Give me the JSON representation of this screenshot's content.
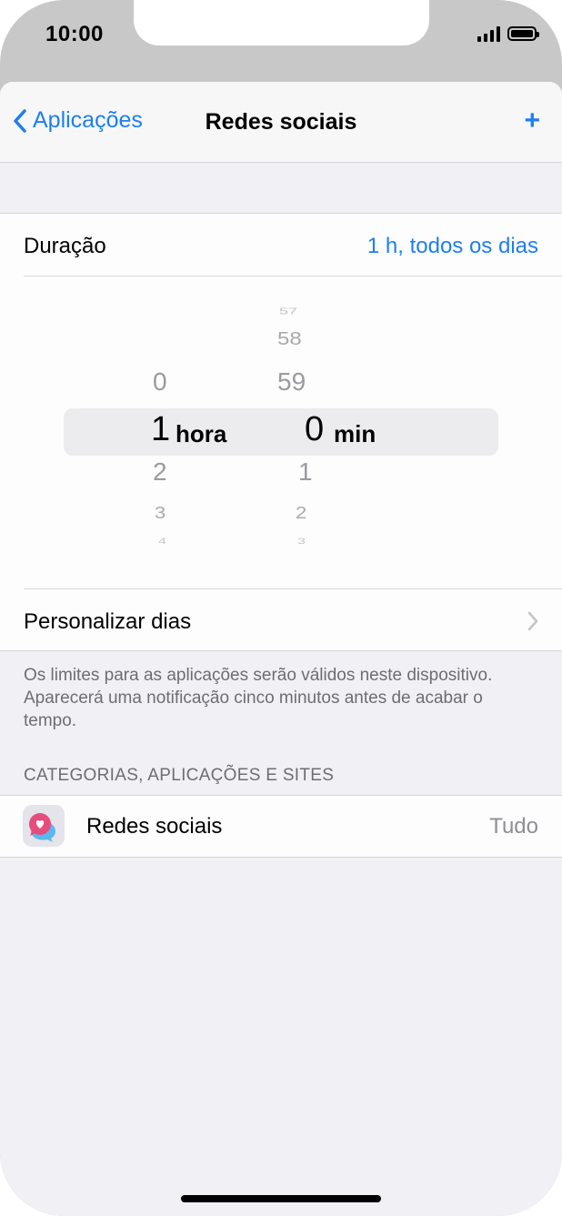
{
  "status_bar": {
    "time": "10:00"
  },
  "nav": {
    "back_label": "Aplicações",
    "title": "Redes sociais",
    "add_label": "+"
  },
  "duration": {
    "label": "Duração",
    "value": "1 h, todos os dias"
  },
  "picker": {
    "hours": [
      "0",
      "1",
      "2",
      "3",
      "4"
    ],
    "hour_unit": "hora",
    "minutes": [
      "57",
      "58",
      "59",
      "0",
      "1",
      "2",
      "3"
    ],
    "minute_unit": "min",
    "selected_hours": "1",
    "selected_minutes": "0"
  },
  "custom_days": {
    "label": "Personalizar dias"
  },
  "footer_note": "Os limites para as aplicações serão válidos neste dispositivo. Aparecerá uma notificação cinco minutos antes de acabar o tempo.",
  "section": {
    "header": "CATEGORIAS, APLICAÇÕES E SITES"
  },
  "app_row": {
    "label": "Redes sociais",
    "value": "Tudo",
    "icon": "social-networks-icon"
  },
  "colors": {
    "accent": "#1d7ff0",
    "secondary_text": "#6d6d72",
    "background": "#f0f0f5"
  }
}
